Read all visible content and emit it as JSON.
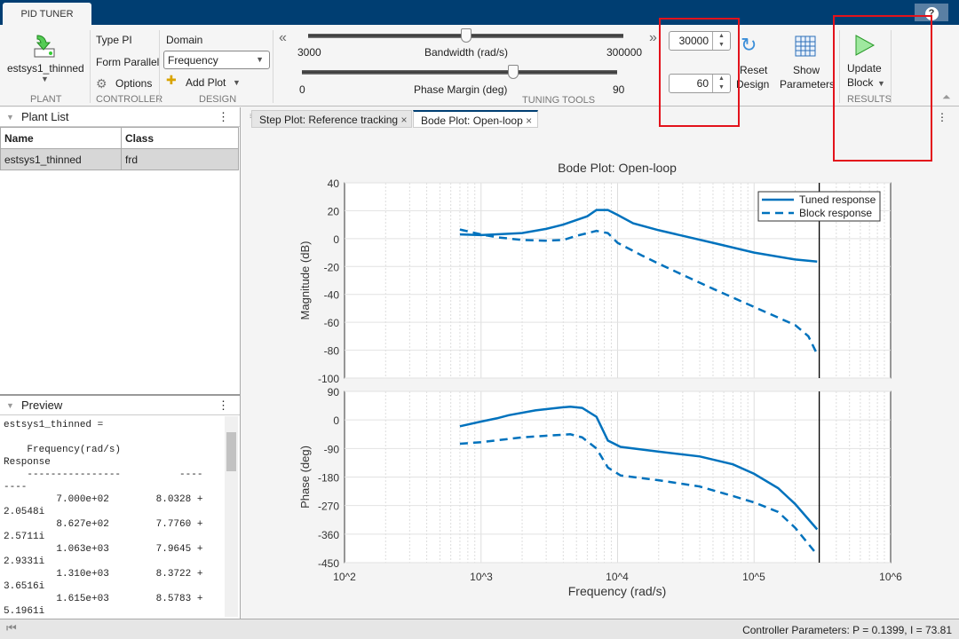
{
  "app": {
    "tab": "PID TUNER",
    "help": "?"
  },
  "plant": {
    "name": "estsys1_thinned",
    "group": "PLANT"
  },
  "controller": {
    "type": "Type PI",
    "form": "Form Parallel",
    "options": "Options",
    "group": "CONTROLLER"
  },
  "design": {
    "domain_label": "Domain",
    "domain_value": "Frequency",
    "add_plot": "Add Plot",
    "group": "DESIGN"
  },
  "tuning": {
    "bw_label": "Bandwidth (rad/s)",
    "bw_min": "3000",
    "bw_max": "300000",
    "bw_value": "30000",
    "pm_label": "Phase Margin (deg)",
    "pm_min": "0",
    "pm_max": "90",
    "pm_value": "60",
    "group": "TUNING TOOLS",
    "reset1": "Reset",
    "reset2": "Design",
    "show1": "Show",
    "show2": "Parameters"
  },
  "results": {
    "update1": "Update",
    "update2": "Block",
    "group": "RESULTS"
  },
  "plant_list": {
    "title": "Plant List",
    "headers": [
      "Name",
      "Class"
    ],
    "rows": [
      [
        "estsys1_thinned",
        "frd"
      ]
    ]
  },
  "preview": {
    "title": "Preview",
    "text": "estsys1_thinned =\n\n    Frequency(rad/s)\nResponse\n    ----------------          ----\n----\n         7.000e+02        8.0328 +\n2.0548i\n         8.627e+02        7.7760 +\n2.5711i\n         1.063e+03        7.9645 +\n2.9331i\n         1.310e+03        8.3722 +\n3.6516i\n         1.615e+03        8.5783 +\n5.1961i"
  },
  "doc_tabs": [
    {
      "label": "Step Plot: Reference tracking"
    },
    {
      "label": "Bode Plot: Open-loop",
      "active": true
    }
  ],
  "status": "Controller Parameters: P = 0.1399, I = 73.81",
  "chart_data": {
    "type": "line",
    "title": "Bode Plot: Open-loop",
    "xlabel": "Frequency  (rad/s)",
    "xscale": "log",
    "xlim": [
      100,
      1000000
    ],
    "x_ticks": [
      "10^2",
      "10^3",
      "10^4",
      "10^5",
      "10^6"
    ],
    "grid": true,
    "legend_placement": "top-right",
    "vertical_marker_x": 300000,
    "color": "#0072bd",
    "magnitude": {
      "ylabel": "Magnitude (dB)",
      "ylim": [
        -100,
        40
      ],
      "yticks": [
        40,
        20,
        0,
        -20,
        -40,
        -60,
        -80,
        -100
      ],
      "series": [
        {
          "name": "Tuned response",
          "style": "solid",
          "x": [
            700,
            1000,
            2000,
            3000,
            4000,
            6000,
            7000,
            8500,
            10000,
            13000,
            20000,
            30000,
            50000,
            100000,
            200000,
            290000
          ],
          "y": [
            3,
            2.5,
            4,
            7,
            10,
            16,
            20.5,
            20.5,
            17,
            11,
            6,
            2,
            -3,
            -10,
            -15,
            -16.5
          ]
        },
        {
          "name": "Block response",
          "style": "dashed",
          "x": [
            700,
            1000,
            1300,
            2000,
            3000,
            4000,
            5000,
            7000,
            8500,
            10000,
            15000,
            20000,
            30000,
            50000,
            100000,
            200000,
            250000,
            290000
          ],
          "y": [
            6.5,
            3,
            1,
            -1,
            -1.5,
            -1,
            2,
            5.5,
            4,
            -3,
            -12,
            -18,
            -26,
            -36,
            -49,
            -62,
            -70,
            -83
          ]
        }
      ]
    },
    "phase": {
      "ylabel": "Phase (deg)",
      "ylim": [
        -450,
        90
      ],
      "yticks": [
        90,
        0,
        -90,
        -180,
        -270,
        -360,
        -450
      ],
      "series": [
        {
          "name": "Tuned response",
          "style": "solid",
          "x": [
            700,
            1000,
            1300,
            1600,
            2500,
            4000,
            4500,
            5500,
            7000,
            8500,
            10500,
            20000,
            40000,
            70000,
            100000,
            150000,
            200000,
            290000
          ],
          "y": [
            -20,
            -5,
            5,
            15,
            30,
            40,
            42,
            38,
            10,
            -65,
            -85,
            -100,
            -115,
            -140,
            -170,
            -215,
            -265,
            -345
          ]
        },
        {
          "name": "Block response",
          "style": "dashed",
          "x": [
            700,
            1000,
            2000,
            3000,
            4500,
            5500,
            7000,
            8500,
            10500,
            20000,
            40000,
            70000,
            100000,
            150000,
            200000,
            290000
          ],
          "y": [
            -75,
            -70,
            -55,
            -50,
            -45,
            -55,
            -90,
            -150,
            -175,
            -190,
            -210,
            -240,
            -260,
            -290,
            -340,
            -425
          ]
        }
      ]
    }
  }
}
